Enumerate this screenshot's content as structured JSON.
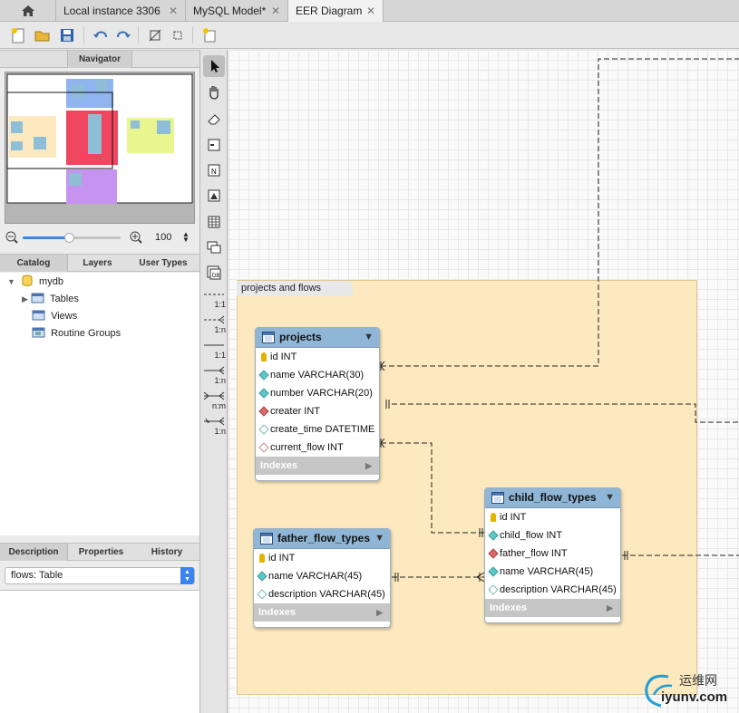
{
  "tabs": [
    {
      "label": "Local instance 3306"
    },
    {
      "label": "MySQL Model*"
    },
    {
      "label": "EER Diagram"
    }
  ],
  "navigator": {
    "label": "Navigator",
    "zoom_value": "100"
  },
  "catalog_tabs": [
    {
      "label": "Catalog"
    },
    {
      "label": "Layers"
    },
    {
      "label": "User Types"
    }
  ],
  "tree": {
    "schema": "mydb",
    "items": [
      {
        "label": "Tables"
      },
      {
        "label": "Views"
      },
      {
        "label": "Routine Groups"
      }
    ]
  },
  "desc_tabs": [
    {
      "label": "Description"
    },
    {
      "label": "Properties"
    },
    {
      "label": "History"
    }
  ],
  "desc_select": "flows: Table",
  "relationship_tools": [
    "1:1",
    "1:n",
    "1:1",
    "1:n",
    "n:m",
    "1:n"
  ],
  "diagram": {
    "layer_name": "projects and flows",
    "indexes_label": "Indexes",
    "tables": [
      {
        "name": "projects",
        "columns": [
          {
            "text": "id INT",
            "icon": "primary-key"
          },
          {
            "text": "name VARCHAR(30)",
            "icon": "column-not-null"
          },
          {
            "text": "number VARCHAR(20)",
            "icon": "column-not-null"
          },
          {
            "text": "creater INT",
            "icon": "foreign-key"
          },
          {
            "text": "create_time DATETIME",
            "icon": "column-nullable"
          },
          {
            "text": "current_flow INT",
            "icon": "foreign-key-nullable"
          }
        ]
      },
      {
        "name": "father_flow_types",
        "columns": [
          {
            "text": "id INT",
            "icon": "primary-key"
          },
          {
            "text": "name VARCHAR(45)",
            "icon": "column-not-null"
          },
          {
            "text": "description VARCHAR(45)",
            "icon": "column-nullable"
          }
        ]
      },
      {
        "name": "child_flow_types",
        "columns": [
          {
            "text": "id INT",
            "icon": "primary-key"
          },
          {
            "text": "child_flow INT",
            "icon": "column-not-null"
          },
          {
            "text": "father_flow INT",
            "icon": "foreign-key"
          },
          {
            "text": "name VARCHAR(45)",
            "icon": "column-not-null"
          },
          {
            "text": "description VARCHAR(45)",
            "icon": "column-nullable"
          }
        ]
      }
    ]
  },
  "watermark": {
    "brand": "运维网",
    "domain": "iyunv.com"
  }
}
